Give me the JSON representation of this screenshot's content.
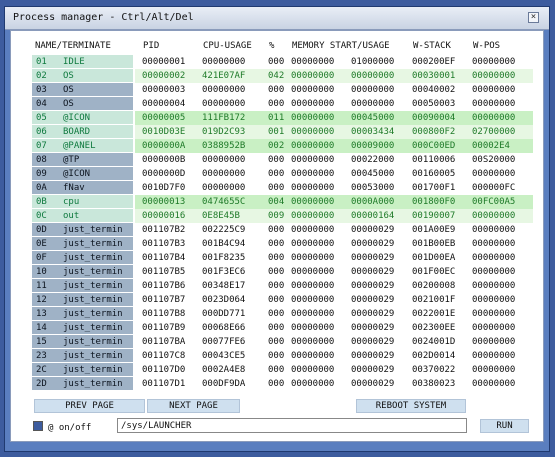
{
  "window": {
    "title": "Process manager - Ctrl/Alt/Del",
    "close_label": "×"
  },
  "columns": [
    "NAME/TERMINATE",
    "PID",
    "CPU-USAGE",
    "%",
    "MEMORY START/USAGE",
    "W-STACK",
    "W-POS"
  ],
  "rows": [
    {
      "id": "01",
      "name": "IDLE",
      "pid": "00000001",
      "cpu": "00000000",
      "pct": "000",
      "mem_start": "00000000",
      "mem_usage": "01000000",
      "wstack": "000200EF",
      "wpos": "00000000",
      "style": "plain",
      "name_style": "light"
    },
    {
      "id": "02",
      "name": "OS",
      "pid": "00000002",
      "cpu": "421E07AF",
      "pct": "042",
      "mem_start": "00000000",
      "mem_usage": "00000000",
      "wstack": "00030001",
      "wpos": "00000000",
      "style": "ok",
      "name_style": "light"
    },
    {
      "id": "03",
      "name": "OS",
      "pid": "00000003",
      "cpu": "00000000",
      "pct": "000",
      "mem_start": "00000000",
      "mem_usage": "00000000",
      "wstack": "00040002",
      "wpos": "00000000",
      "style": "plain",
      "name_style": "dark"
    },
    {
      "id": "04",
      "name": "OS",
      "pid": "00000004",
      "cpu": "00000000",
      "pct": "000",
      "mem_start": "00000000",
      "mem_usage": "00000000",
      "wstack": "00050003",
      "wpos": "00000000",
      "style": "plain",
      "name_style": "dark"
    },
    {
      "id": "05",
      "name": "@ICON",
      "pid": "00000005",
      "cpu": "111FB172",
      "pct": "011",
      "mem_start": "00000000",
      "mem_usage": "00045000",
      "wstack": "00090004",
      "wpos": "00000000",
      "style": "hl",
      "name_style": "light"
    },
    {
      "id": "06",
      "name": "BOARD",
      "pid": "0010D03E",
      "cpu": "019D2C93",
      "pct": "001",
      "mem_start": "00000000",
      "mem_usage": "00003434",
      "wstack": "000800F2",
      "wpos": "02700000",
      "style": "ok",
      "name_style": "light"
    },
    {
      "id": "07",
      "name": "@PANEL",
      "pid": "0000000A",
      "cpu": "0388952B",
      "pct": "002",
      "mem_start": "00000000",
      "mem_usage": "00009000",
      "wstack": "000C00ED",
      "wpos": "00002E4",
      "style": "hl",
      "name_style": "light"
    },
    {
      "id": "08",
      "name": "@TP",
      "pid": "0000000B",
      "cpu": "00000000",
      "pct": "000",
      "mem_start": "00000000",
      "mem_usage": "00022000",
      "wstack": "00110006",
      "wpos": "00S20000",
      "style": "plain",
      "name_style": "dark"
    },
    {
      "id": "09",
      "name": "@ICON",
      "pid": "0000000D",
      "cpu": "00000000",
      "pct": "000",
      "mem_start": "00000000",
      "mem_usage": "00045000",
      "wstack": "00160005",
      "wpos": "00000000",
      "style": "plain",
      "name_style": "dark"
    },
    {
      "id": "0A",
      "name": "fNav",
      "pid": "0010D7F0",
      "cpu": "00000000",
      "pct": "000",
      "mem_start": "00000000",
      "mem_usage": "00053000",
      "wstack": "001700F1",
      "wpos": "000000FC",
      "style": "plain",
      "name_style": "dark"
    },
    {
      "id": "0B",
      "name": "cpu",
      "pid": "00000013",
      "cpu": "0474655C",
      "pct": "004",
      "mem_start": "00000000",
      "mem_usage": "0000A000",
      "wstack": "001800F0",
      "wpos": "00FC00A5",
      "style": "hl",
      "name_style": "light"
    },
    {
      "id": "0C",
      "name": "out",
      "pid": "00000016",
      "cpu": "0E8E45B",
      "pct": "009",
      "mem_start": "00000000",
      "mem_usage": "00000164",
      "wstack": "00190007",
      "wpos": "00000000",
      "style": "ok",
      "name_style": "light"
    },
    {
      "id": "0D",
      "name": "just_termin",
      "pid": "001107B2",
      "cpu": "002225C9",
      "pct": "000",
      "mem_start": "00000000",
      "mem_usage": "00000029",
      "wstack": "001A00E9",
      "wpos": "00000000",
      "style": "plain",
      "name_style": "dark"
    },
    {
      "id": "0E",
      "name": "just_termin",
      "pid": "001107B3",
      "cpu": "001B4C94",
      "pct": "000",
      "mem_start": "00000000",
      "mem_usage": "00000029",
      "wstack": "001B00EB",
      "wpos": "00000000",
      "style": "plain",
      "name_style": "dark"
    },
    {
      "id": "0F",
      "name": "just_termin",
      "pid": "001107B4",
      "cpu": "001F8235",
      "pct": "000",
      "mem_start": "00000000",
      "mem_usage": "00000029",
      "wstack": "001D00EA",
      "wpos": "00000000",
      "style": "plain",
      "name_style": "dark"
    },
    {
      "id": "10",
      "name": "just_termin",
      "pid": "001107B5",
      "cpu": "001F3EC6",
      "pct": "000",
      "mem_start": "00000000",
      "mem_usage": "00000029",
      "wstack": "001F00EC",
      "wpos": "00000000",
      "style": "plain",
      "name_style": "dark"
    },
    {
      "id": "11",
      "name": "just_termin",
      "pid": "001107B6",
      "cpu": "00348E17",
      "pct": "000",
      "mem_start": "00000000",
      "mem_usage": "00000029",
      "wstack": "00200008",
      "wpos": "00000000",
      "style": "plain",
      "name_style": "dark"
    },
    {
      "id": "12",
      "name": "just_termin",
      "pid": "001107B7",
      "cpu": "0023D064",
      "pct": "000",
      "mem_start": "00000000",
      "mem_usage": "00000029",
      "wstack": "0021001F",
      "wpos": "00000000",
      "style": "plain",
      "name_style": "dark"
    },
    {
      "id": "13",
      "name": "just_termin",
      "pid": "001107B8",
      "cpu": "000DD771",
      "pct": "000",
      "mem_start": "00000000",
      "mem_usage": "00000029",
      "wstack": "0022001E",
      "wpos": "00000000",
      "style": "plain",
      "name_style": "dark"
    },
    {
      "id": "14",
      "name": "just_termin",
      "pid": "001107B9",
      "cpu": "00068E66",
      "pct": "000",
      "mem_start": "00000000",
      "mem_usage": "00000029",
      "wstack": "002300EE",
      "wpos": "00000000",
      "style": "plain",
      "name_style": "dark"
    },
    {
      "id": "15",
      "name": "just_termin",
      "pid": "001107BA",
      "cpu": "00077FE6",
      "pct": "000",
      "mem_start": "00000000",
      "mem_usage": "00000029",
      "wstack": "0024001D",
      "wpos": "00000000",
      "style": "plain",
      "name_style": "dark"
    },
    {
      "id": "23",
      "name": "just_termin",
      "pid": "001107C8",
      "cpu": "00043CE5",
      "pct": "000",
      "mem_start": "00000000",
      "mem_usage": "00000029",
      "wstack": "002D0014",
      "wpos": "00000000",
      "style": "plain",
      "name_style": "dark"
    },
    {
      "id": "2C",
      "name": "just_termin",
      "pid": "001107D0",
      "cpu": "0002A4E8",
      "pct": "000",
      "mem_start": "00000000",
      "mem_usage": "00000029",
      "wstack": "00370022",
      "wpos": "00000000",
      "style": "plain",
      "name_style": "dark"
    },
    {
      "id": "2D",
      "name": "just_termin",
      "pid": "001107D1",
      "cpu": "000DF9DA",
      "pct": "000",
      "mem_start": "00000000",
      "mem_usage": "00000029",
      "wstack": "00380023",
      "wpos": "00000000",
      "style": "plain",
      "name_style": "dark"
    }
  ],
  "buttons": {
    "prev": "PREV PAGE",
    "next": "NEXT PAGE",
    "reboot": "REBOOT SYSTEM",
    "run": "RUN"
  },
  "footer": {
    "onoff_label": "@ on/off",
    "command_value": "/sys/LAUNCHER"
  }
}
